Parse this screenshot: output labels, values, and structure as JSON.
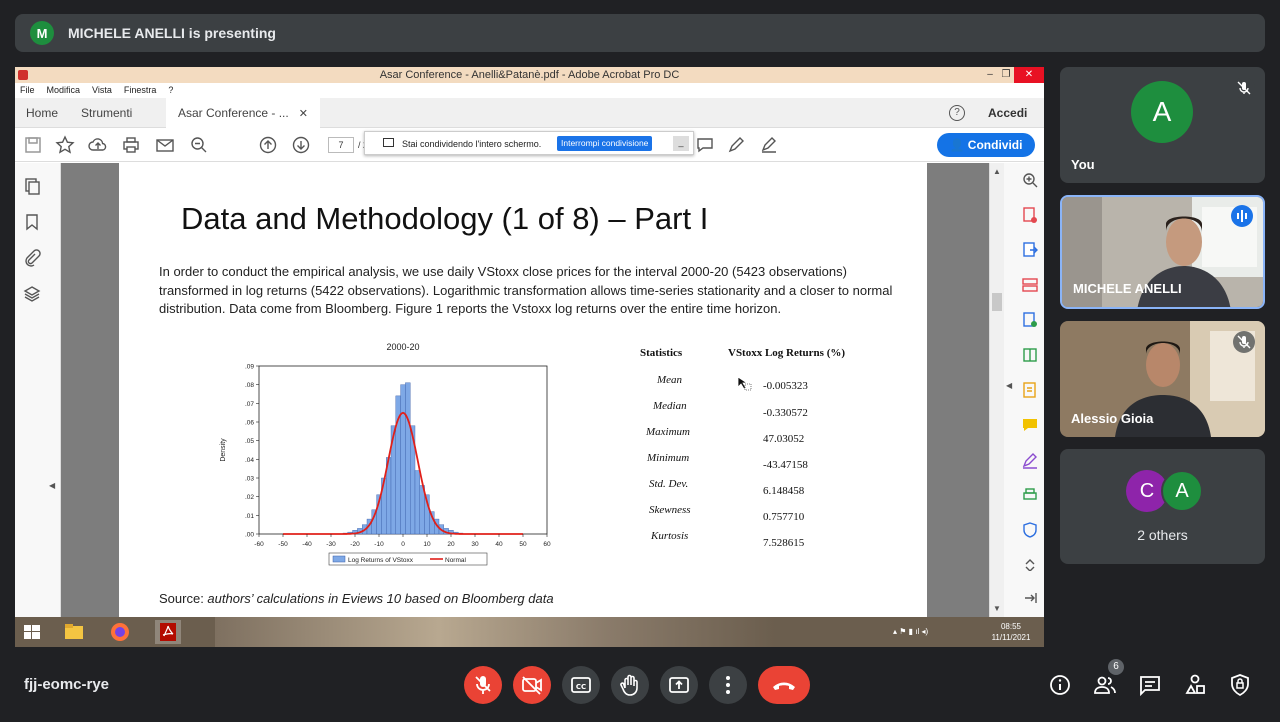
{
  "meet": {
    "presenter_initial": "M",
    "presenter_banner": "MICHELE ANELLI is presenting",
    "meeting_code": "fjj-eomc-rye",
    "participants_badge": "6",
    "tiles": [
      {
        "initial": "A",
        "name": "You",
        "muted": true
      },
      {
        "name": "MICHELE ANELLI",
        "speaking": true
      },
      {
        "name": "Alessio Gioia",
        "muted": true
      },
      {
        "initials": [
          "C",
          "A"
        ],
        "label": "2 others"
      }
    ],
    "colors": {
      "accent": "#1a73e8",
      "danger": "#ea4335",
      "surface": "#3c4043",
      "background": "#202124"
    }
  },
  "acrobat": {
    "window_title": "Asar Conference - Anelli&Patanè.pdf - Adobe Acrobat Pro DC",
    "menus": [
      "File",
      "Modifica",
      "Vista",
      "Finestra",
      "?"
    ],
    "tabs": {
      "home": "Home",
      "tools": "Strumenti",
      "doc": "Asar Conference - ..."
    },
    "sign_in": "Accedi",
    "page_current": "7",
    "page_sep": "/ 2",
    "share_banner": "Stai condividendo l'intero schermo.",
    "stop_share": "Interrompi condivisione",
    "share_button": "Condividi",
    "clock_time": "08:55",
    "clock_date": "11/11/2021"
  },
  "slide": {
    "title": "Data and Methodology (1 of 8) – Part I",
    "paragraph": "In order to conduct the empirical analysis, we use daily VStoxx close prices for the interval 2000-20 (5423 observations) transformed in log returns (5422 observations). Logarithmic transformation allows time-series stationarity and a closer to normal distribution. Data come from Bloomberg. Figure 1 reports the Vstoxx log returns over the entire time horizon.",
    "source_prefix": "Source: ",
    "source_italic": "authors’ calculations in Eviews 10 based on Bloomberg data",
    "stats_header": [
      "Statistics",
      "VStoxx Log Returns (%)"
    ],
    "stats": [
      {
        "label": "Mean",
        "value": "-0.005323"
      },
      {
        "label": "Median",
        "value": "-0.330572"
      },
      {
        "label": "Maximum",
        "value": "47.03052"
      },
      {
        "label": "Minimum",
        "value": "-43.47158"
      },
      {
        "label": "Std. Dev.",
        "value": "6.148458"
      },
      {
        "label": "Skewness",
        "value": "0.757710"
      },
      {
        "label": "Kurtosis",
        "value": "7.528615"
      }
    ]
  },
  "chart_data": {
    "type": "bar",
    "title": "2000-20",
    "xlabel": "",
    "ylabel": "Density",
    "xlim": [
      -60,
      60
    ],
    "ylim": [
      0,
      0.09
    ],
    "xticks": [
      "-60",
      "-50",
      "-40",
      "-30",
      "-20",
      "-10",
      "0",
      "10",
      "20",
      "30",
      "40",
      "50",
      "60"
    ],
    "yticks": [
      ".00",
      ".01",
      ".02",
      ".03",
      ".04",
      ".05",
      ".06",
      ".07",
      ".08",
      ".09"
    ],
    "legend": [
      "Log Returns of VStoxx",
      "Normal"
    ],
    "legend_position": "bottom",
    "bin_width": 2,
    "series": [
      {
        "name": "Log Returns of VStoxx",
        "bins": [
          {
            "x": -24,
            "y": 0.0005
          },
          {
            "x": -22,
            "y": 0.001
          },
          {
            "x": -20,
            "y": 0.002
          },
          {
            "x": -18,
            "y": 0.003
          },
          {
            "x": -16,
            "y": 0.005
          },
          {
            "x": -14,
            "y": 0.008
          },
          {
            "x": -12,
            "y": 0.013
          },
          {
            "x": -10,
            "y": 0.021
          },
          {
            "x": -8,
            "y": 0.03
          },
          {
            "x": -6,
            "y": 0.041
          },
          {
            "x": -4,
            "y": 0.058
          },
          {
            "x": -2,
            "y": 0.074
          },
          {
            "x": 0,
            "y": 0.08
          },
          {
            "x": 2,
            "y": 0.081
          },
          {
            "x": 4,
            "y": 0.058
          },
          {
            "x": 6,
            "y": 0.034
          },
          {
            "x": 8,
            "y": 0.026
          },
          {
            "x": 10,
            "y": 0.021
          },
          {
            "x": 12,
            "y": 0.012
          },
          {
            "x": 14,
            "y": 0.008
          },
          {
            "x": 16,
            "y": 0.005
          },
          {
            "x": 18,
            "y": 0.003
          },
          {
            "x": 20,
            "y": 0.002
          },
          {
            "x": 22,
            "y": 0.001
          },
          {
            "x": 24,
            "y": 0.0005
          }
        ],
        "color": "#7ea8e6"
      },
      {
        "name": "Normal",
        "mean": -0.005323,
        "sd": 6.148458,
        "color": "#e0201a"
      }
    ]
  }
}
